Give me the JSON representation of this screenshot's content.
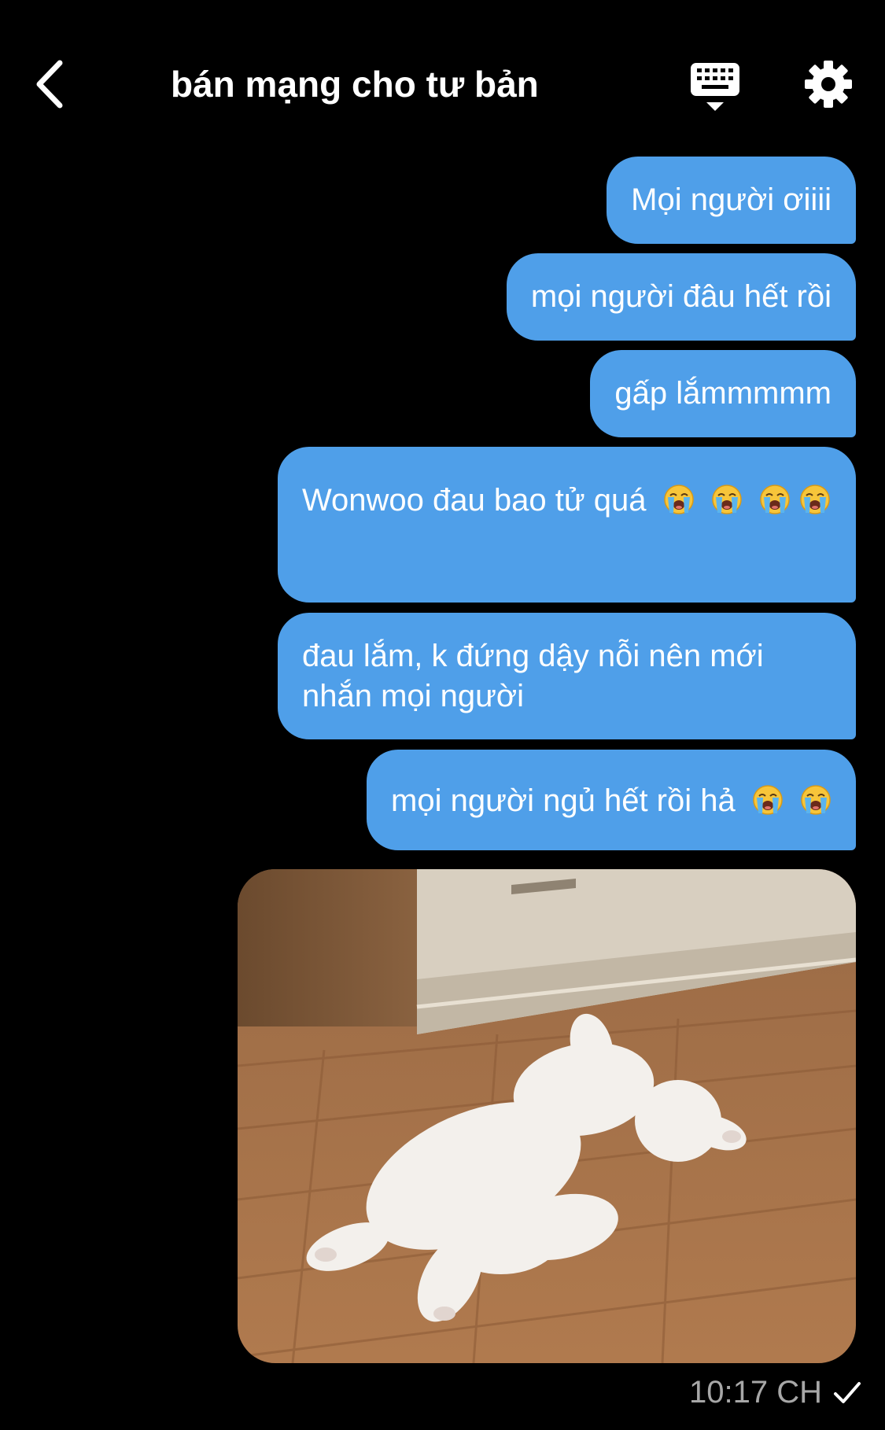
{
  "header": {
    "title": "bán mạng cho tư bản",
    "icons": {
      "back": "chevron-left-icon",
      "keyboard": "keyboard-icon",
      "settings": "gear-icon"
    }
  },
  "messages": [
    {
      "text": "Mọi người ơiiii"
    },
    {
      "text": "mọi người đâu hết rồi"
    },
    {
      "text": "gấp lắmmmmm"
    },
    {
      "text": "Wonwoo đau bao tử quá",
      "emoji": "loudly-crying-face",
      "emoji_count": 4
    },
    {
      "text": "đau lắm, k đứng dậy nỗi nên mới nhắn mọi người"
    },
    {
      "text": "mọi người ngủ hết rồi hả",
      "emoji": "loudly-crying-face",
      "emoji_count": 2
    }
  ],
  "photo": {
    "subject": "white-cat-lying-on-floor-photo"
  },
  "status": {
    "time": "10:17 CH",
    "read_icon": "checkmark-icon"
  },
  "colors": {
    "bubble": "#4f9fe9",
    "background": "#000000",
    "timestamp": "#a7a7a7"
  }
}
